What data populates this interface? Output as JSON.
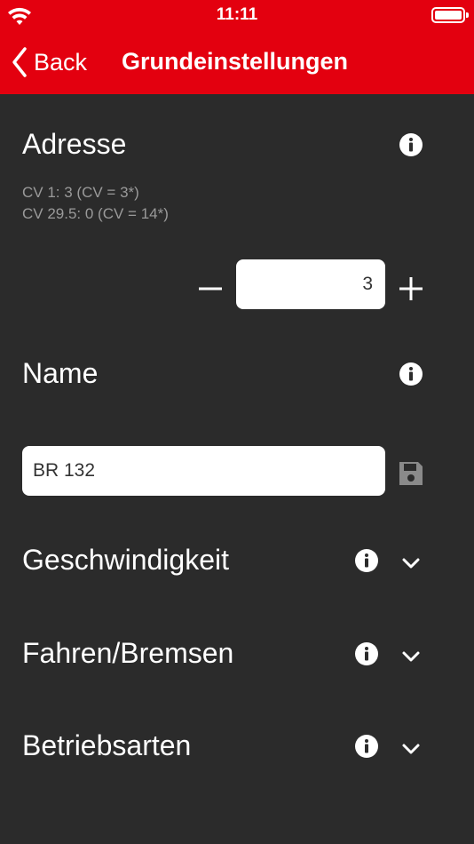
{
  "status_bar": {
    "time": "11:11"
  },
  "nav": {
    "back_label": "Back",
    "title": "Grundeinstellungen"
  },
  "adresse": {
    "title": "Adresse",
    "cv_lines": [
      "CV 1: 3 (CV = 3*)",
      "CV 29.5: 0 (CV = 14*)"
    ],
    "value": "3"
  },
  "name": {
    "title": "Name",
    "value": "BR 132"
  },
  "sections": [
    {
      "title": "Geschwindigkeit"
    },
    {
      "title": "Fahren/Bremsen"
    },
    {
      "title": "Betriebsarten"
    }
  ],
  "colors": {
    "accent": "#e3000f",
    "background": "#2b2b2b",
    "muted_text": "#9a9a9a"
  },
  "icons": {
    "info": "info-circle-icon",
    "chevron": "chevron-down-icon",
    "save": "floppy-disk-icon",
    "back": "chevron-left-icon"
  }
}
